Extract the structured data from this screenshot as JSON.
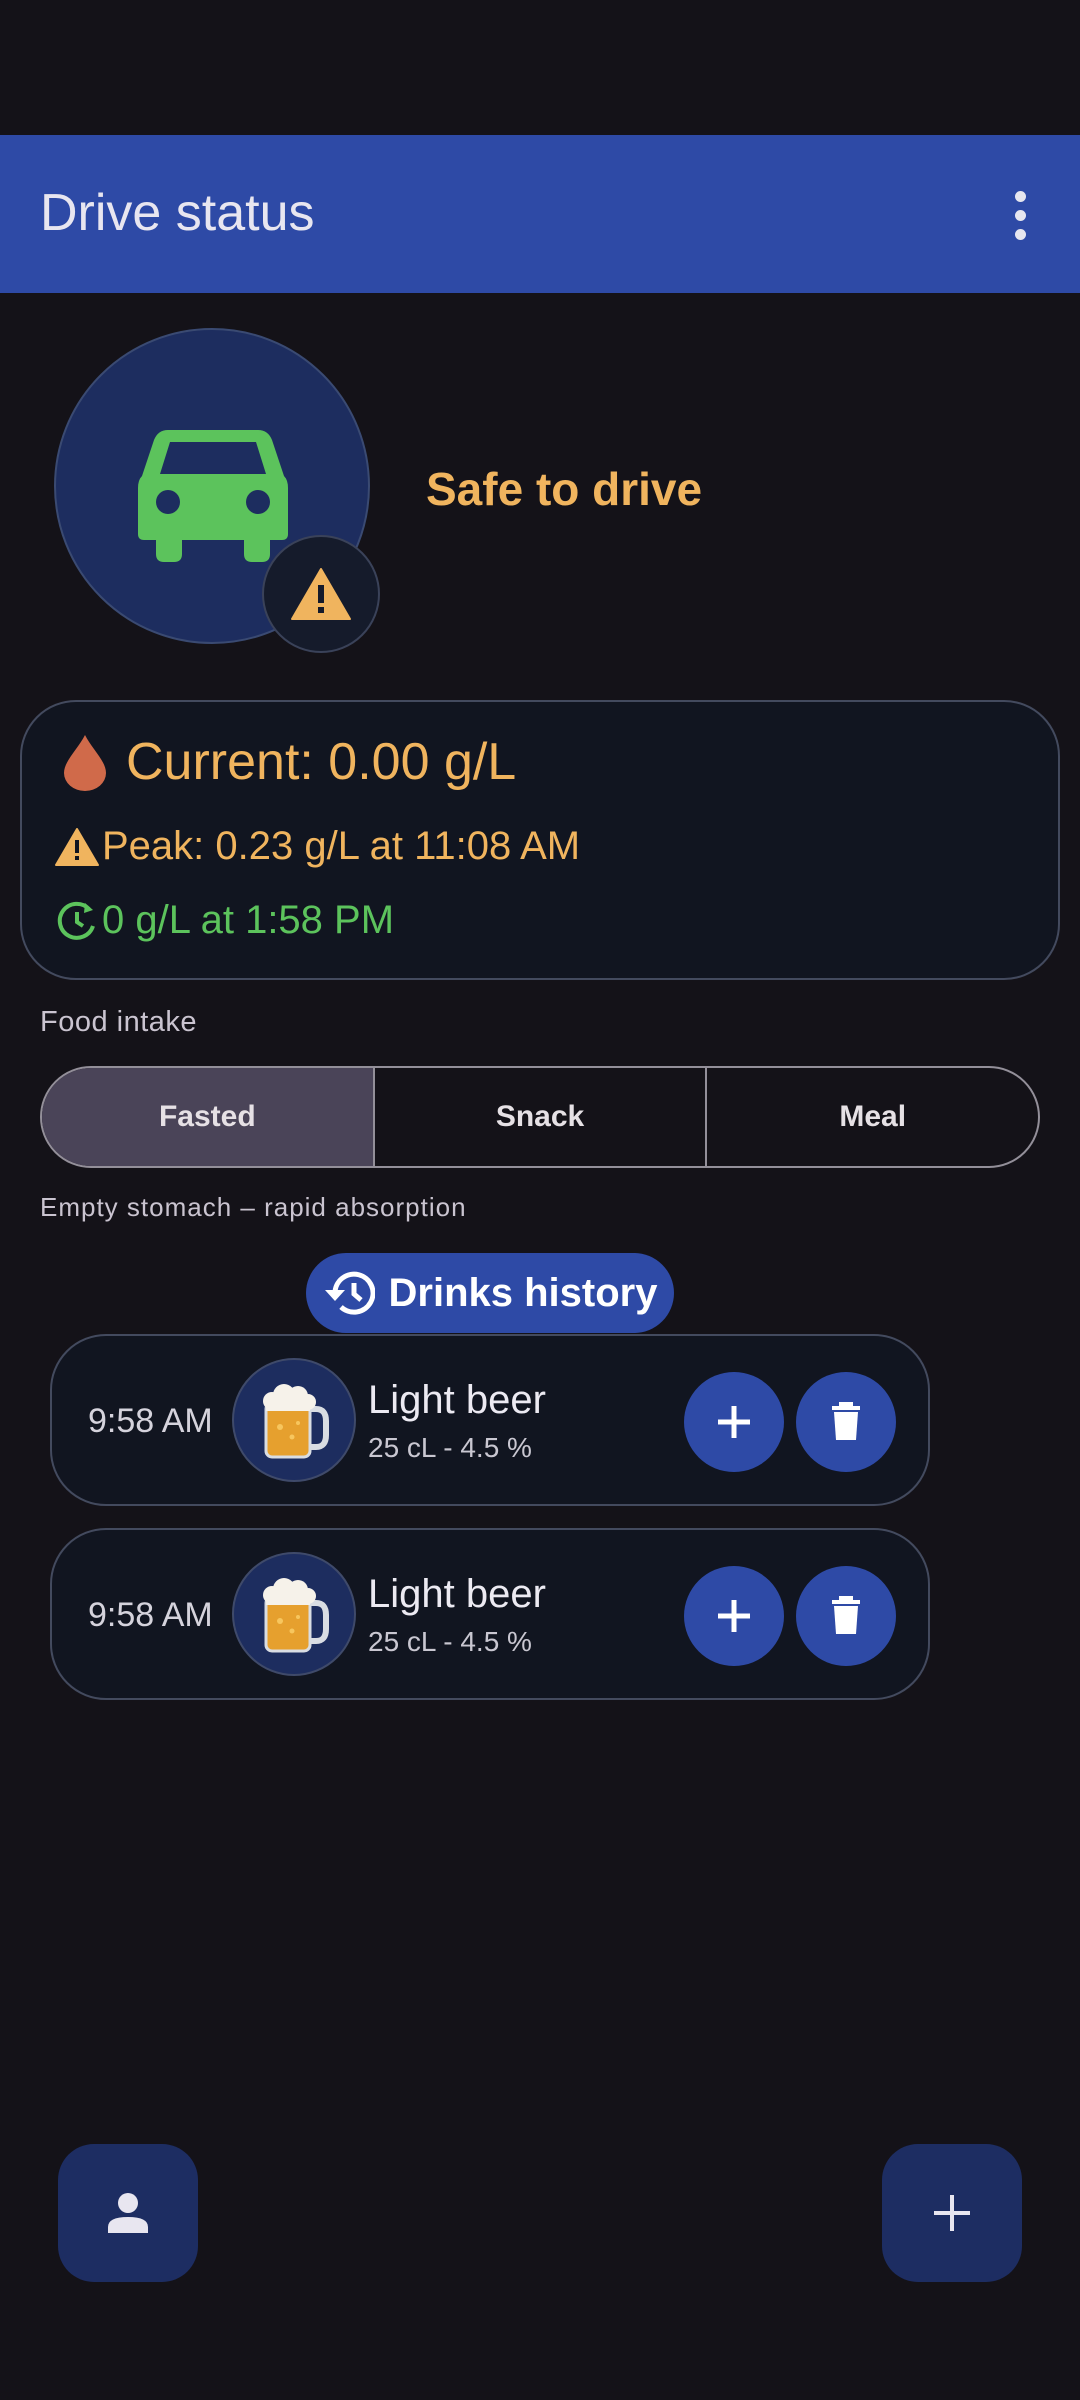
{
  "app_bar": {
    "title": "Drive status",
    "menu_icon": "more-vert-icon"
  },
  "status": {
    "label": "Safe to drive",
    "main_icon": "car-icon",
    "badge_icon": "warning-icon",
    "colors": {
      "car": "#5cc35c",
      "label": "#f0b45e",
      "warning": "#f0b45e"
    }
  },
  "bac": {
    "current": "Current: 0.00 g/L",
    "peak": "Peak: 0.23 g/L at 11:08 AM",
    "sober": "0 g/L at 1:58 PM",
    "icons": {
      "current": "drop-icon",
      "peak": "warning-icon",
      "sober": "timer-icon"
    },
    "colors": {
      "drop": "#d06a4a",
      "text": "#f0b45e",
      "sober": "#5cc35c"
    }
  },
  "food": {
    "label": "Food intake",
    "options": [
      "Fasted",
      "Snack",
      "Meal"
    ],
    "selected": "Fasted",
    "hint": "Empty stomach – rapid absorption"
  },
  "history": {
    "label": "Drinks history",
    "icon": "history-icon",
    "drinks": [
      {
        "time": "9:58 AM",
        "name": "Light beer",
        "detail": "25 cL - 4.5 %",
        "icon": "beer-mug-icon"
      },
      {
        "time": "9:58 AM",
        "name": "Light beer",
        "detail": "25 cL - 4.5 %",
        "icon": "beer-mug-icon"
      }
    ]
  },
  "fabs": {
    "profile_icon": "person-icon",
    "add_icon": "plus-icon"
  },
  "theme": {
    "primary": "#2e4aa6",
    "background": "#141218",
    "surface": "#111520"
  }
}
